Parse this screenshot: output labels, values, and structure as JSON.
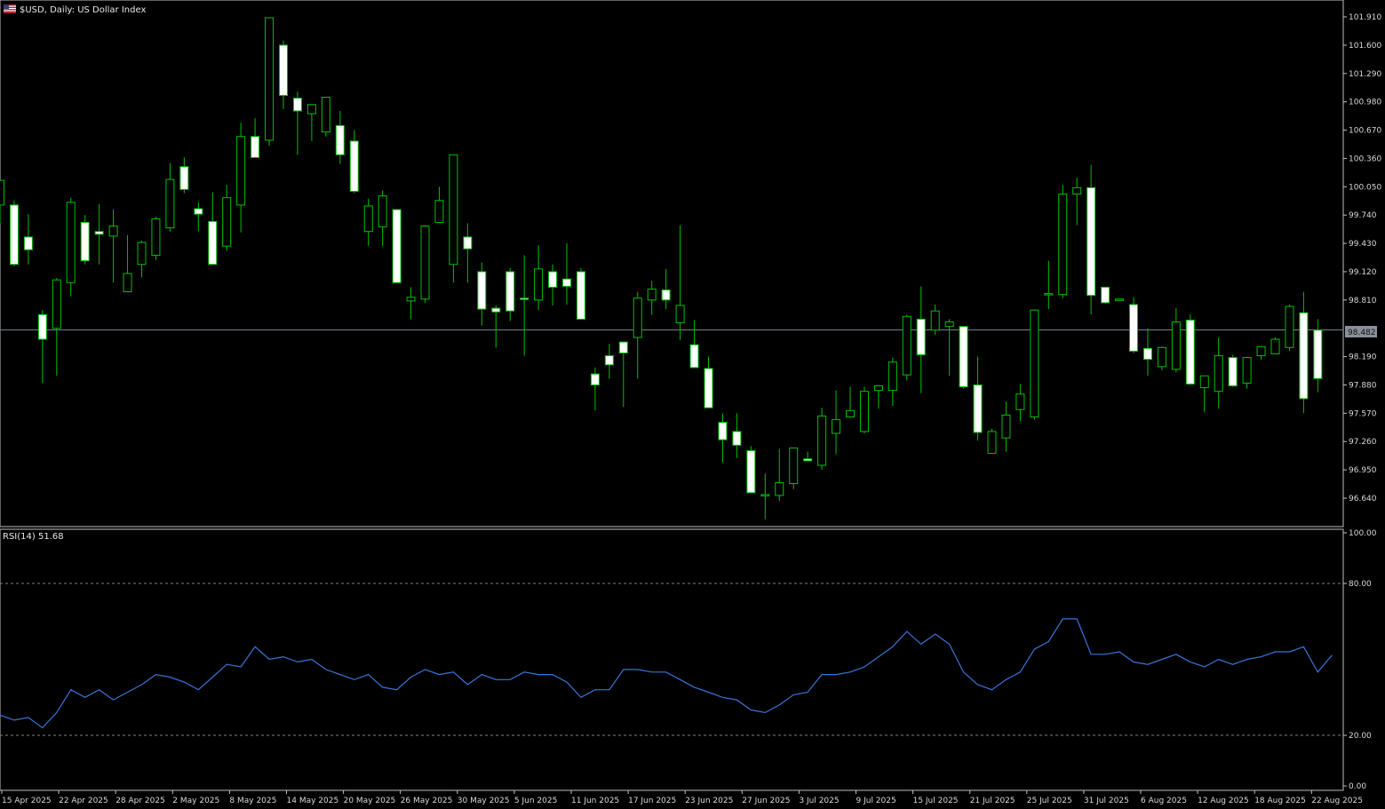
{
  "header": {
    "flag_icon": "us-flag-icon",
    "title": "$USD, Daily:  US Dollar Index"
  },
  "current_price": "98.482",
  "colors": {
    "background": "#000000",
    "bull_body": "#000000",
    "bear_body": "#ffffff",
    "wick": "#00c000",
    "grid_line": "#808080",
    "price_line": "#708090",
    "rsi_line": "#3a74d8",
    "axis_text": "#d8d8d8"
  },
  "chart_data": [
    {
      "type": "candlestick",
      "title": "$USD, Daily:  US Dollar Index",
      "y_ticks": [
        "101.910",
        "101.600",
        "101.290",
        "100.980",
        "100.670",
        "100.360",
        "100.050",
        "99.740",
        "99.430",
        "99.120",
        "98.810",
        "98.190",
        "97.880",
        "97.570",
        "97.260",
        "96.950",
        "96.640"
      ],
      "ylim": [
        96.4,
        102.0
      ],
      "x_tick_labels": [
        "15 Apr 2025",
        "22 Apr 2025",
        "28 Apr 2025",
        "2 May 2025",
        "8 May 2025",
        "14 May 2025",
        "20 May 2025",
        "26 May 2025",
        "30 May 2025",
        "5 Jun 2025",
        "11 Jun 2025",
        "17 Jun 2025",
        "23 Jun 2025",
        "27 Jun 2025",
        "3 Jul 2025",
        "9 Jul 2025",
        "15 Jul 2025",
        "21 Jul 2025",
        "25 Jul 2025",
        "31 Jul 2025",
        "6 Aug 2025",
        "12 Aug 2025",
        "18 Aug 2025",
        "22 Aug 2025"
      ],
      "last_price": 98.482,
      "ohlc": [
        [
          99.85,
          100.12,
          99.65,
          100.12
        ],
        [
          99.85,
          99.9,
          99.18,
          99.2
        ],
        [
          99.5,
          99.75,
          99.2,
          99.36
        ],
        [
          98.65,
          98.7,
          97.9,
          98.38
        ],
        [
          98.5,
          99.05,
          97.98,
          99.03
        ],
        [
          99.0,
          99.93,
          98.85,
          99.88
        ],
        [
          99.66,
          99.74,
          99.2,
          99.24
        ],
        [
          99.56,
          99.86,
          99.2,
          99.53
        ],
        [
          99.51,
          99.8,
          99.0,
          99.62
        ],
        [
          98.9,
          99.52,
          98.9,
          99.1
        ],
        [
          99.2,
          99.46,
          99.06,
          99.44
        ],
        [
          99.3,
          99.72,
          99.25,
          99.7
        ],
        [
          99.6,
          100.31,
          99.56,
          100.13
        ],
        [
          100.27,
          100.37,
          99.98,
          100.02
        ],
        [
          99.81,
          99.88,
          99.56,
          99.75
        ],
        [
          99.67,
          99.99,
          99.25,
          99.2
        ],
        [
          99.4,
          100.07,
          99.35,
          99.93
        ],
        [
          99.85,
          100.75,
          99.55,
          100.6
        ],
        [
          100.6,
          100.8,
          100.37,
          100.37
        ],
        [
          100.56,
          101.9,
          100.5,
          101.9
        ],
        [
          101.6,
          101.65,
          100.9,
          101.05
        ],
        [
          101.02,
          101.09,
          100.4,
          100.88
        ],
        [
          100.85,
          100.92,
          100.55,
          100.95
        ],
        [
          100.65,
          100.97,
          100.6,
          101.03
        ],
        [
          100.72,
          100.88,
          100.3,
          100.4
        ],
        [
          100.55,
          100.67,
          99.98,
          100.0
        ],
        [
          99.56,
          99.92,
          99.4,
          99.84
        ],
        [
          99.61,
          100.01,
          99.4,
          99.95
        ],
        [
          99.8,
          99.79,
          99.0,
          99.0
        ],
        [
          98.8,
          98.95,
          98.6,
          98.84
        ],
        [
          98.82,
          99.63,
          98.78,
          99.62
        ],
        [
          99.66,
          100.05,
          99.85,
          99.9
        ],
        [
          99.2,
          100.05,
          99.0,
          100.4
        ],
        [
          99.5,
          99.65,
          99.0,
          99.37
        ],
        [
          99.12,
          99.22,
          98.53,
          98.71
        ],
        [
          98.72,
          98.75,
          98.29,
          98.68
        ],
        [
          99.12,
          99.16,
          98.58,
          98.69
        ],
        [
          98.83,
          99.3,
          98.2,
          98.82
        ],
        [
          98.81,
          99.41,
          98.7,
          99.15
        ],
        [
          99.12,
          99.2,
          98.75,
          98.95
        ],
        [
          99.04,
          99.43,
          98.76,
          98.96
        ],
        [
          99.12,
          99.16,
          98.62,
          98.6
        ],
        [
          98.0,
          98.07,
          97.6,
          97.88
        ],
        [
          98.2,
          98.33,
          97.95,
          98.1
        ],
        [
          98.35,
          98.0,
          97.64,
          98.23
        ],
        [
          98.4,
          98.9,
          97.95,
          98.83
        ],
        [
          98.81,
          99.02,
          98.65,
          98.93
        ],
        [
          98.92,
          99.15,
          98.71,
          98.81
        ],
        [
          98.56,
          99.63,
          98.37,
          98.75
        ],
        [
          98.32,
          98.59,
          98.42,
          98.07
        ],
        [
          98.06,
          98.19,
          97.82,
          97.63
        ],
        [
          97.47,
          97.57,
          97.03,
          97.28
        ],
        [
          97.37,
          97.57,
          97.08,
          97.22
        ],
        [
          97.16,
          97.21,
          96.7,
          96.7
        ],
        [
          96.68,
          96.91,
          96.41,
          96.68
        ],
        [
          96.67,
          97.18,
          96.61,
          96.81
        ],
        [
          96.8,
          97.19,
          96.74,
          97.19
        ],
        [
          97.07,
          97.15,
          97.05,
          97.05
        ],
        [
          97.0,
          97.63,
          96.95,
          97.54
        ],
        [
          97.35,
          97.82,
          97.12,
          97.5
        ],
        [
          97.53,
          97.86,
          97.52,
          97.6
        ],
        [
          97.37,
          97.86,
          97.35,
          97.81
        ],
        [
          97.82,
          97.84,
          97.62,
          97.87
        ],
        [
          97.82,
          98.18,
          97.65,
          98.13
        ],
        [
          97.99,
          98.65,
          97.93,
          98.63
        ],
        [
          98.6,
          98.96,
          97.79,
          98.21
        ],
        [
          98.48,
          98.76,
          98.43,
          98.69
        ],
        [
          98.52,
          98.6,
          97.98,
          98.57
        ],
        [
          98.52,
          98.48,
          97.84,
          97.86
        ],
        [
          97.88,
          98.19,
          97.27,
          97.36
        ],
        [
          97.13,
          97.4,
          97.19,
          97.37
        ],
        [
          97.3,
          97.7,
          97.15,
          97.55
        ],
        [
          97.61,
          97.89,
          97.48,
          97.78
        ],
        [
          97.53,
          98.71,
          97.5,
          98.7
        ],
        [
          98.88,
          99.24,
          98.71,
          98.88
        ],
        [
          98.87,
          100.07,
          98.83,
          99.97
        ],
        [
          99.97,
          100.15,
          99.63,
          100.04
        ],
        [
          100.04,
          100.29,
          98.65,
          98.86
        ],
        [
          98.95,
          98.91,
          98.77,
          98.78
        ],
        [
          98.82,
          98.79,
          98.81,
          98.82
        ],
        [
          98.76,
          98.84,
          98.23,
          98.25
        ],
        [
          98.28,
          98.5,
          97.98,
          98.16
        ],
        [
          98.08,
          98.3,
          98.04,
          98.29
        ],
        [
          98.05,
          98.72,
          98.02,
          98.57
        ],
        [
          98.59,
          98.65,
          97.88,
          97.89
        ],
        [
          97.85,
          97.95,
          97.58,
          97.98
        ],
        [
          97.81,
          98.4,
          97.62,
          98.2
        ],
        [
          98.18,
          98.21,
          97.86,
          97.87
        ],
        [
          97.9,
          98.19,
          97.84,
          98.18
        ],
        [
          98.2,
          98.3,
          98.16,
          98.3
        ],
        [
          98.22,
          98.4,
          98.24,
          98.38
        ],
        [
          98.29,
          98.76,
          98.25,
          98.74
        ],
        [
          98.67,
          98.9,
          97.57,
          97.73
        ],
        [
          98.48,
          98.6,
          97.8,
          97.95
        ]
      ]
    },
    {
      "type": "line",
      "title": "RSI(14) 51.68",
      "y_ticks": [
        "100.00",
        "80.00",
        "20.00",
        "0.00"
      ],
      "ylim": [
        0,
        100
      ],
      "levels": [
        80,
        20
      ],
      "values": [
        28,
        26,
        27,
        23,
        29,
        38,
        35,
        38,
        34,
        37,
        40,
        44,
        43,
        41,
        38,
        43,
        48,
        47,
        55,
        50,
        51,
        49,
        50,
        46,
        44,
        42,
        44,
        39,
        38,
        43,
        46,
        44,
        45,
        40,
        44,
        42,
        42,
        45,
        44,
        44,
        41,
        35,
        38,
        38,
        46,
        46,
        45,
        45,
        42,
        39,
        37,
        35,
        34,
        30,
        29,
        32,
        36,
        37,
        44,
        44,
        45,
        47,
        51,
        55,
        61,
        56,
        60,
        56,
        45,
        40,
        38,
        42,
        45,
        54,
        57,
        66,
        66,
        52,
        52,
        53,
        49,
        48,
        50,
        52,
        49,
        47,
        50,
        48,
        50,
        51,
        53,
        53,
        55,
        45,
        51.68
      ]
    }
  ]
}
